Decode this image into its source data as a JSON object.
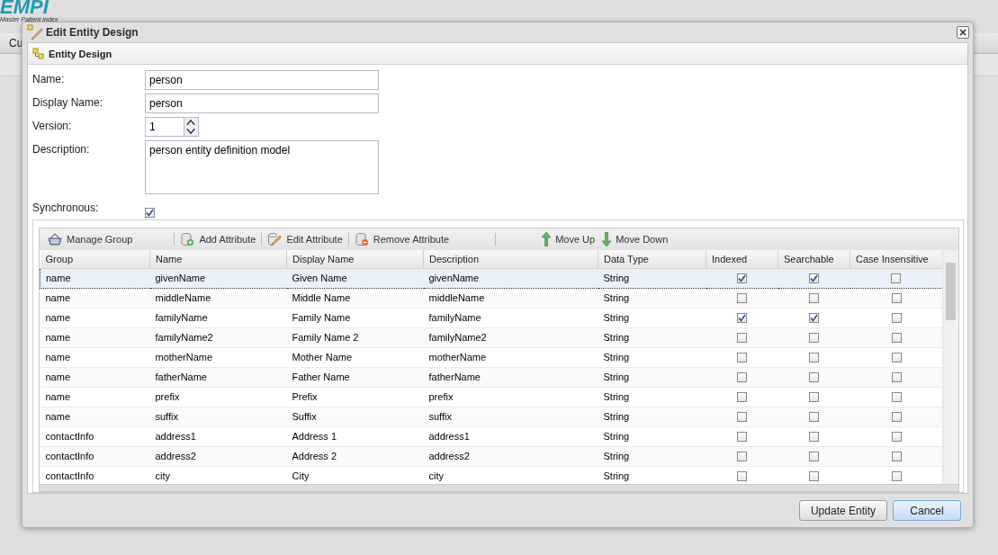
{
  "app": {
    "logo": "EMPI",
    "tagline": "Master Patient Index",
    "menu": [
      "Cu"
    ]
  },
  "dialog": {
    "title": "Edit Entity Design",
    "panel_title": "Entity Design",
    "form": [
      {
        "kind": "text",
        "label": "Name:",
        "value": "person"
      },
      {
        "kind": "text",
        "label": "Display Name:",
        "value": "person"
      },
      {
        "kind": "spinner",
        "label": "Version:",
        "value": "1"
      },
      {
        "kind": "textarea",
        "label": "Description:",
        "value": "person entity definition model"
      },
      {
        "kind": "checkbox",
        "label": "Synchronous:",
        "checked": true
      }
    ],
    "toolbar": [
      {
        "kind": "basket",
        "label": "Manage Group"
      },
      {
        "kind": "add",
        "label": "Add Attribute"
      },
      {
        "kind": "edit",
        "label": "Edit Attribute"
      },
      {
        "kind": "remove",
        "label": "Remove Attribute"
      },
      {
        "kind": "up",
        "label": "Move Up"
      },
      {
        "kind": "down",
        "label": "Move Down"
      }
    ],
    "table": {
      "columns": [
        "Group",
        "Name",
        "Display Name",
        "Description",
        "Data Type",
        "Indexed",
        "Searchable",
        "Case Insensitive"
      ],
      "rows": [
        {
          "group": "name",
          "name": "givenName",
          "display_name": "Given Name",
          "description": "givenName",
          "data_type": "String",
          "indexed": true,
          "searchable": true,
          "case_insensitive": false,
          "selected": true
        },
        {
          "group": "name",
          "name": "middleName",
          "display_name": "Middle Name",
          "description": "middleName",
          "data_type": "String",
          "indexed": false,
          "searchable": false,
          "case_insensitive": false,
          "selected": false
        },
        {
          "group": "name",
          "name": "familyName",
          "display_name": "Family Name",
          "description": "familyName",
          "data_type": "String",
          "indexed": true,
          "searchable": true,
          "case_insensitive": false,
          "selected": false
        },
        {
          "group": "name",
          "name": "familyName2",
          "display_name": "Family Name 2",
          "description": "familyName2",
          "data_type": "String",
          "indexed": false,
          "searchable": false,
          "case_insensitive": false,
          "selected": false
        },
        {
          "group": "name",
          "name": "motherName",
          "display_name": "Mother Name",
          "description": "motherName",
          "data_type": "String",
          "indexed": false,
          "searchable": false,
          "case_insensitive": false,
          "selected": false
        },
        {
          "group": "name",
          "name": "fatherName",
          "display_name": "Father Name",
          "description": "fatherName",
          "data_type": "String",
          "indexed": false,
          "searchable": false,
          "case_insensitive": false,
          "selected": false
        },
        {
          "group": "name",
          "name": "prefix",
          "display_name": "Prefix",
          "description": "prefix",
          "data_type": "String",
          "indexed": false,
          "searchable": false,
          "case_insensitive": false,
          "selected": false
        },
        {
          "group": "name",
          "name": "suffix",
          "display_name": "Suffix",
          "description": "suffix",
          "data_type": "String",
          "indexed": false,
          "searchable": false,
          "case_insensitive": false,
          "selected": false
        },
        {
          "group": "contactInfo",
          "name": "address1",
          "display_name": "Address 1",
          "description": "address1",
          "data_type": "String",
          "indexed": false,
          "searchable": false,
          "case_insensitive": false,
          "selected": false
        },
        {
          "group": "contactInfo",
          "name": "address2",
          "display_name": "Address 2",
          "description": "address2",
          "data_type": "String",
          "indexed": false,
          "searchable": false,
          "case_insensitive": false,
          "selected": false
        },
        {
          "group": "contactInfo",
          "name": "city",
          "display_name": "City",
          "description": "city",
          "data_type": "String",
          "indexed": false,
          "searchable": false,
          "case_insensitive": false,
          "selected": false
        }
      ]
    },
    "buttons": [
      "Update Entity",
      "Cancel"
    ]
  }
}
